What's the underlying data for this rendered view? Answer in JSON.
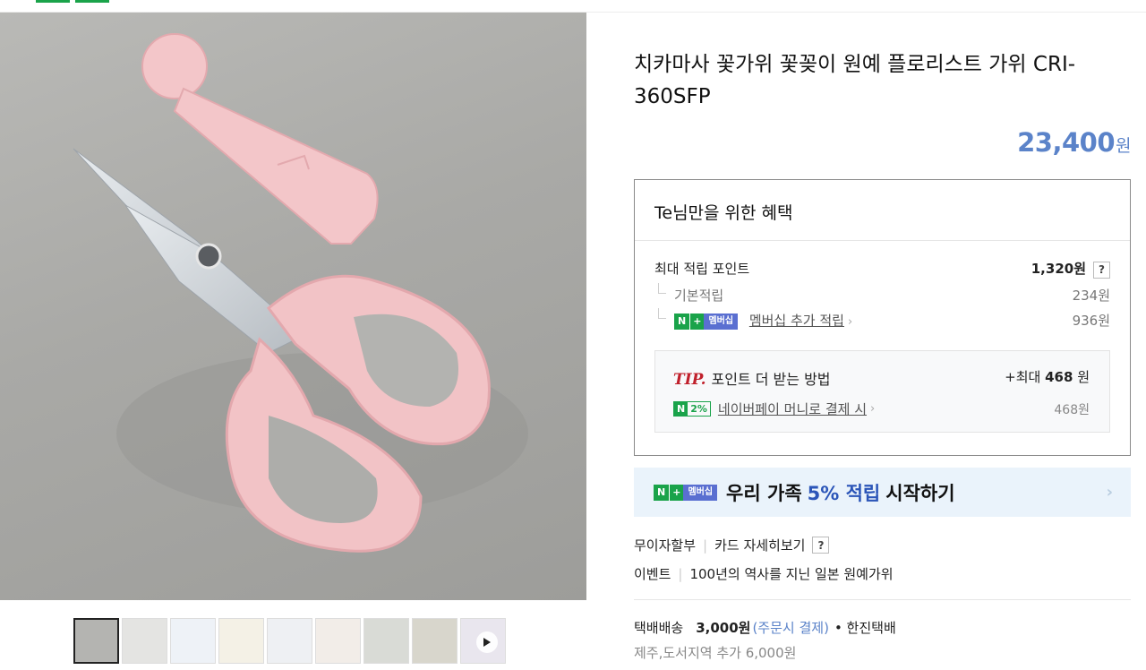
{
  "product": {
    "title": "치카마사 꽃가위 꽃꽂이 원예 플로리스트 가위 CRI-360SFP",
    "price": "23,400",
    "price_unit": "원"
  },
  "benefit": {
    "heading": "Te님만을 위한 혜택",
    "max_points_label": "최대 적립 포인트",
    "max_points_value": "1,320원",
    "help": "?",
    "basic_label": "기본적립",
    "basic_value": "234원",
    "membership_label": "멤버십 추가 적립",
    "membership_value": "936원",
    "badge_n": "N",
    "badge_plus": "+",
    "badge_member": "멤버십",
    "tip": {
      "tip_word": "TIP.",
      "title": "포인트 더 받는 방법",
      "max_prefix": "+최대",
      "max_value": "468",
      "max_unit": "원",
      "pay_badge_n": "N",
      "pay_badge_pct": "2%",
      "pay_label": "네이버페이 머니로 결제 시",
      "pay_value": "468원"
    }
  },
  "promo": {
    "pre": "우리 가족",
    "highlight": "5% 적립",
    "post": "시작하기"
  },
  "info": {
    "installment": "무이자할부",
    "card_detail": "카드 자세히보기",
    "event_label": "이벤트",
    "event_text": "100년의 역사를 지닌 일본 원예가위",
    "ship_label": "택배배송",
    "ship_price": "3,000원",
    "ship_note": "(주문시 결제)",
    "ship_courier": "• 한진택배",
    "ship_extra": "제주,도서지역 추가 6,000원"
  },
  "colors": {
    "price": "#5b83c9",
    "naver_green": "#1aa34a",
    "tip_red": "#c0202b",
    "promo_bg": "#eaf3fb",
    "scissors_pink": "#f2c3c6"
  }
}
